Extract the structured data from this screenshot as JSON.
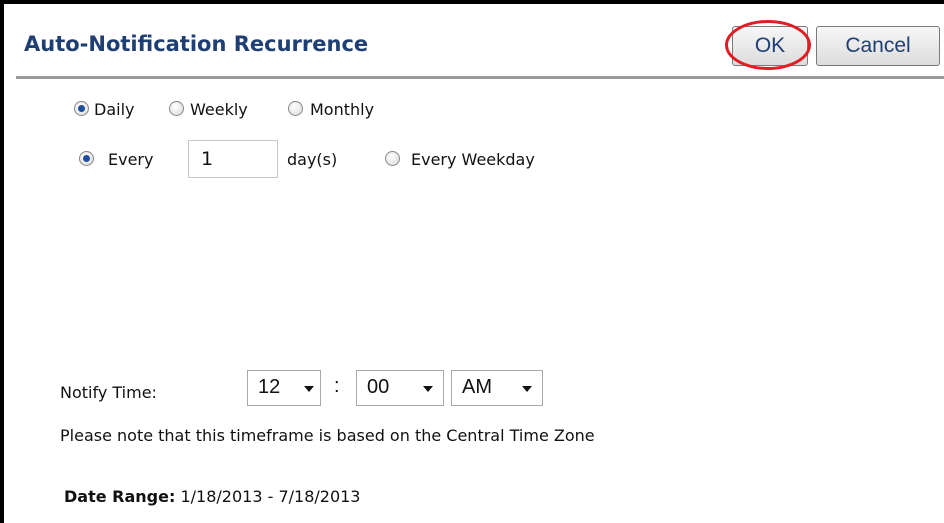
{
  "dialog": {
    "title": "Auto-Notification Recurrence",
    "ok_label": "OK",
    "cancel_label": "Cancel"
  },
  "recurrence": {
    "options": [
      "Daily",
      "Weekly",
      "Monthly"
    ],
    "selected": "Daily"
  },
  "daily": {
    "every_label": "Every",
    "every_value": "1",
    "days_suffix": "day(s)",
    "weekday_label": "Every Weekday",
    "selected": "Every"
  },
  "notify": {
    "label": "Notify Time:",
    "hour": "12",
    "separator": ":",
    "minute": "00",
    "ampm": "AM",
    "note": "Please note that this timeframe is based on the Central Time Zone"
  },
  "date_range": {
    "label": "Date Range:",
    "value": "1/18/2013 - 7/18/2013"
  },
  "colors": {
    "title_color": "#1f3f73",
    "highlight_circle": "#e31b23",
    "radio_selected": "#1c4f9c"
  }
}
